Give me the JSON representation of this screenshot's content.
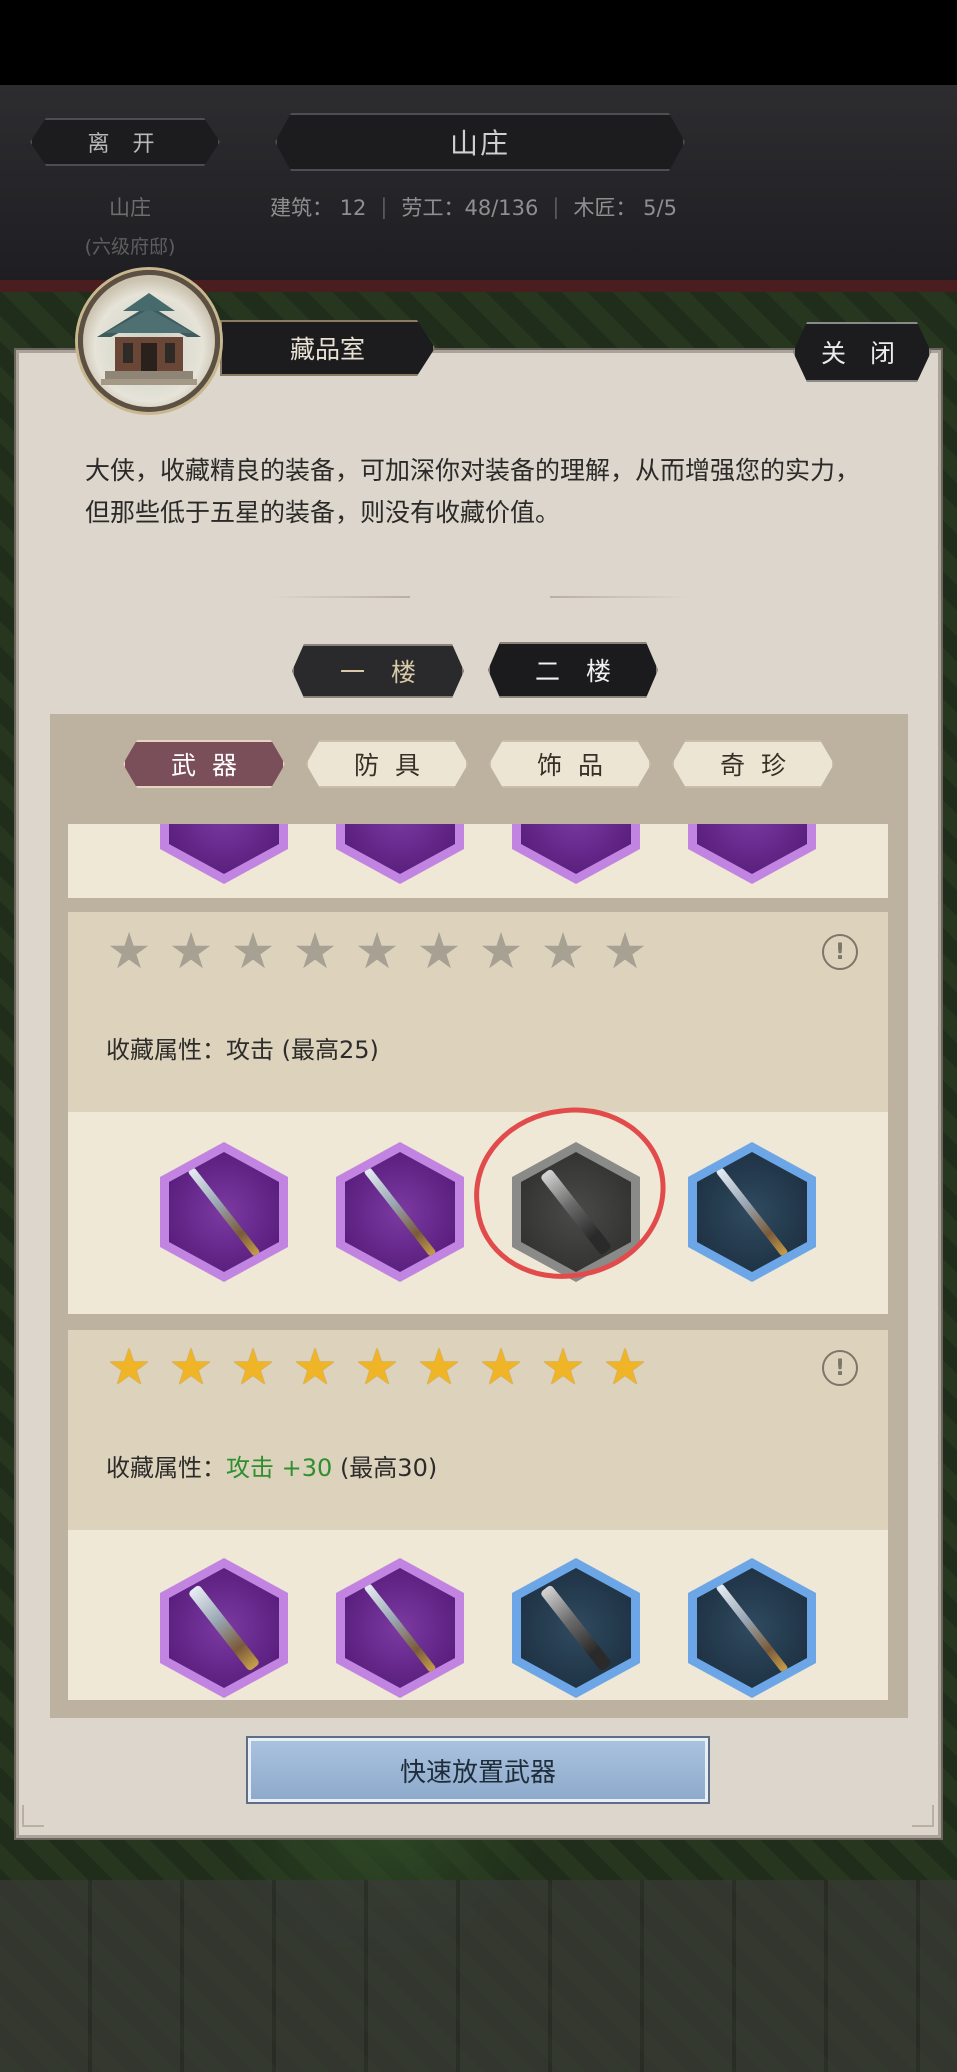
{
  "header": {
    "leave_label": "离 开",
    "title": "山庄",
    "stats": {
      "buildings_label": "建筑：",
      "buildings_value": "12",
      "labor_label": "劳工：",
      "labor_value": "48/136",
      "carpenter_label": "木匠：",
      "carpenter_value": "5/5"
    },
    "villa_label": "山庄",
    "villa_sub": "(六级府邸)"
  },
  "modal": {
    "room_title": "藏品室",
    "close_label": "关 闭",
    "description": "大侠，收藏精良的装备，可加深你对装备的理解，从而增强您的实力，但那些低于五星的装备，则没有收藏价值。",
    "floors": [
      {
        "label": "一楼",
        "selected": false
      },
      {
        "label": "二楼",
        "selected": true
      }
    ],
    "tabs": [
      {
        "label": "武器",
        "selected": true
      },
      {
        "label": "防具",
        "selected": false
      },
      {
        "label": "饰品",
        "selected": false
      },
      {
        "label": "奇珍",
        "selected": false
      }
    ],
    "cards": [
      {
        "stars": 9,
        "stars_filled": 0,
        "attr_label": "收藏属性：",
        "attr_value": "攻击",
        "attr_bonus": "",
        "attr_max": "(最高25)",
        "items": [
          {
            "rarity": "purple",
            "icon": "spear-weapon-icon"
          },
          {
            "rarity": "purple",
            "icon": "spear-weapon-icon"
          },
          {
            "rarity": "grey",
            "icon": "staff-weapon-icon"
          },
          {
            "rarity": "blue",
            "icon": "spear-weapon-icon"
          }
        ]
      },
      {
        "stars": 9,
        "stars_filled": 9,
        "attr_label": "收藏属性：",
        "attr_value": "攻击",
        "attr_bonus": "+30",
        "attr_max": "(最高30)",
        "items": [
          {
            "rarity": "purple",
            "icon": "sword-weapon-icon"
          },
          {
            "rarity": "purple",
            "icon": "spear-weapon-icon"
          },
          {
            "rarity": "blue",
            "icon": "blade-weapon-icon"
          },
          {
            "rarity": "blue",
            "icon": "spear-weapon-icon"
          }
        ]
      }
    ],
    "quick_place_label": "快速放置武器"
  },
  "colors": {
    "selected_tab": "#7b4f5a",
    "purple_rarity": "#5a1f7e",
    "blue_rarity": "#1f3344",
    "grey_rarity": "#333331",
    "star_gold": "#f0b527",
    "star_grey": "#a7a194",
    "bonus_green": "#2f8f2f",
    "highlight_red": "#e24b4b"
  }
}
